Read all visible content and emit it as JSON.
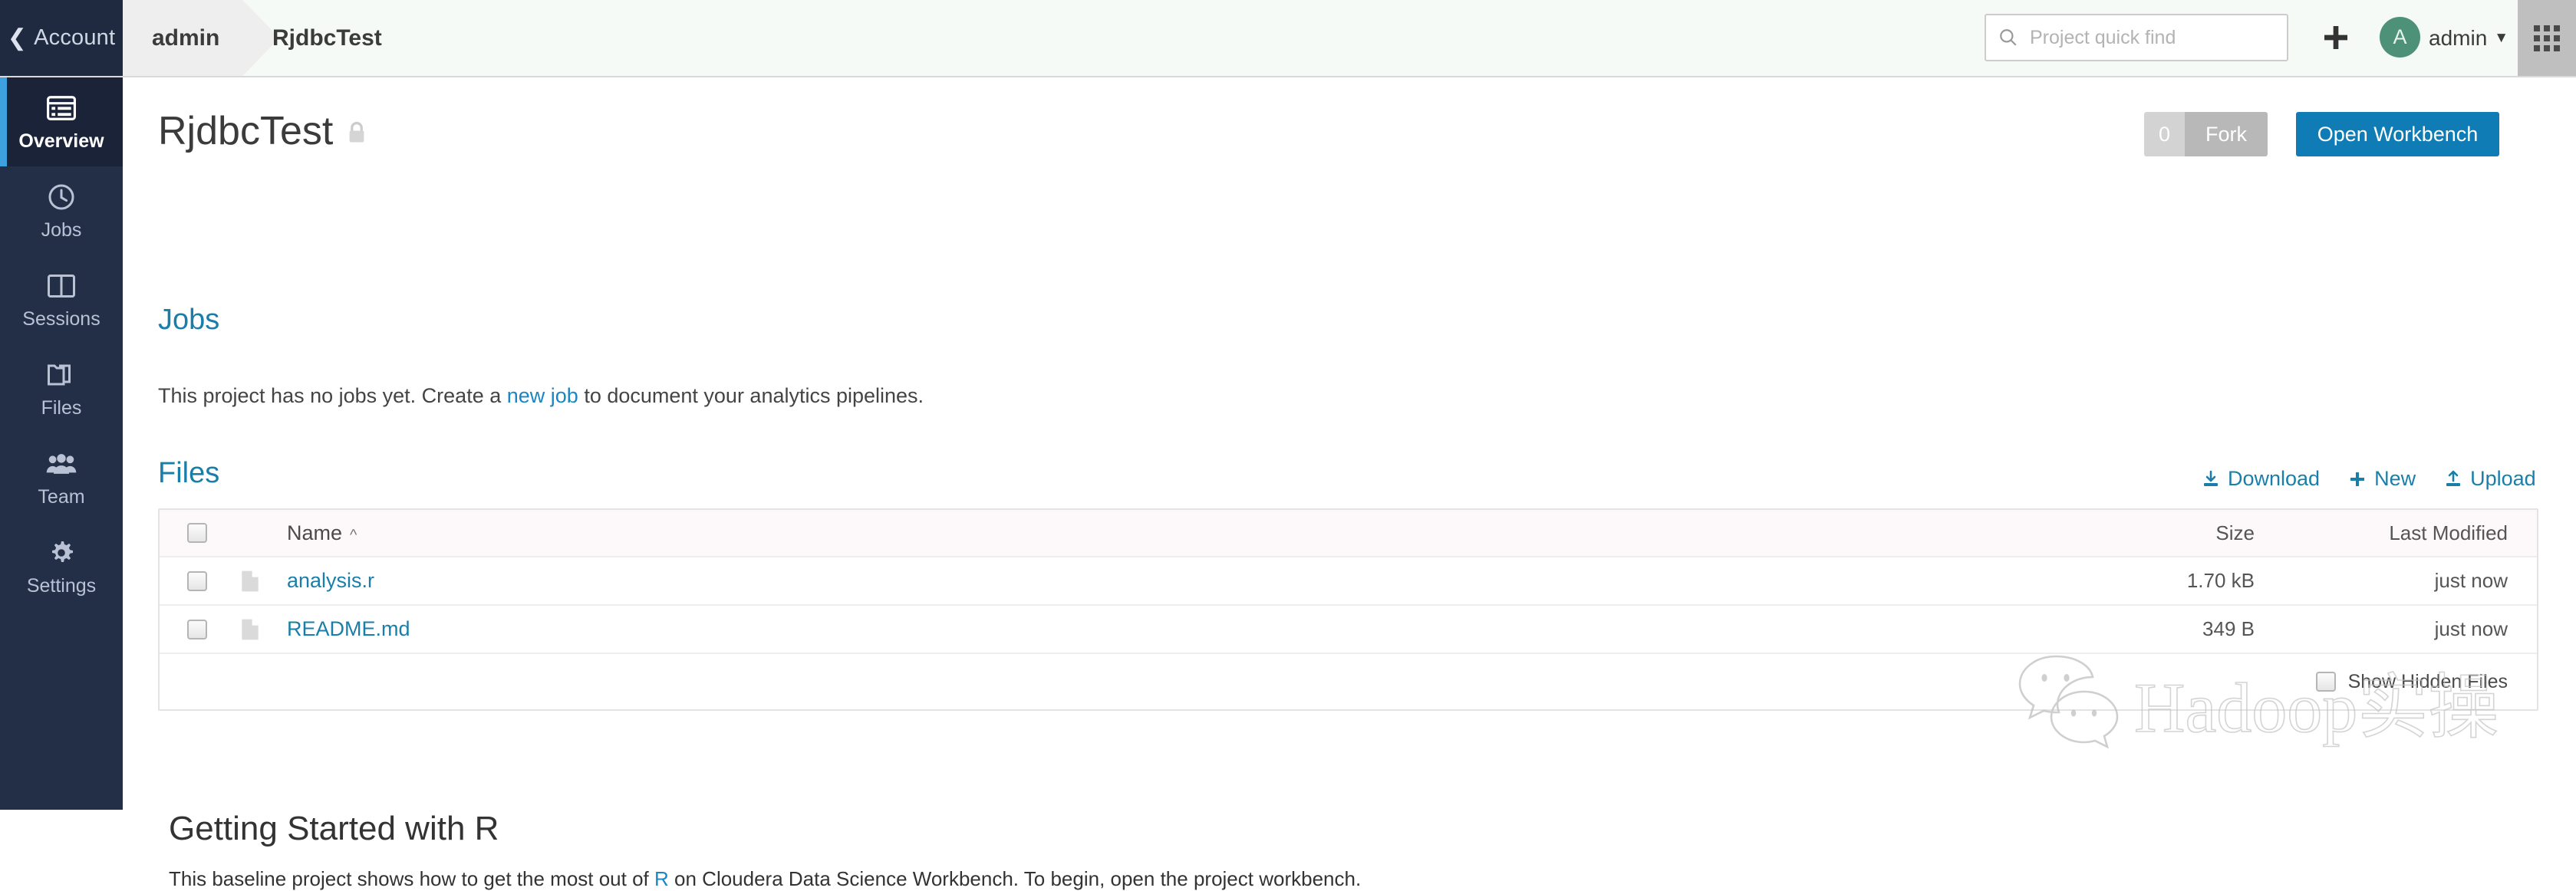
{
  "topbar": {
    "account_label": "Account",
    "back_chevron_icon": "chevron-left-icon",
    "breadcrumb": {
      "owner": "admin",
      "project": "RjdbcTest"
    },
    "search": {
      "placeholder": "Project quick find",
      "value": "",
      "icon": "search-icon"
    },
    "add_icon": "plus-icon",
    "avatar_initial": "A",
    "user_label": "admin",
    "user_caret_icon": "caret-down-icon",
    "app_grid_icon": "app-grid-icon"
  },
  "sidebar": {
    "items": [
      {
        "label": "Overview",
        "icon": "overview-icon",
        "active": true
      },
      {
        "label": "Jobs",
        "icon": "clock-icon",
        "active": false
      },
      {
        "label": "Sessions",
        "icon": "columns-icon",
        "active": false
      },
      {
        "label": "Files",
        "icon": "files-icon",
        "active": false
      },
      {
        "label": "Team",
        "icon": "team-icon",
        "active": false
      },
      {
        "label": "Settings",
        "icon": "gear-icon",
        "active": false
      }
    ]
  },
  "project": {
    "title": "RjdbcTest",
    "visibility_icon": "lock-icon",
    "fork": {
      "count": "0",
      "label": "Fork"
    },
    "open_workbench_label": "Open Workbench"
  },
  "jobs": {
    "heading": "Jobs",
    "empty_text_before": "This project has no jobs yet. Create a ",
    "empty_link": "new job",
    "empty_text_after": " to document your analytics pipelines."
  },
  "files": {
    "heading": "Files",
    "actions": [
      {
        "label": "Download",
        "icon": "download-icon"
      },
      {
        "label": "New",
        "icon": "plus-icon"
      },
      {
        "label": "Upload",
        "icon": "upload-icon"
      }
    ],
    "columns": {
      "name": "Name",
      "size": "Size",
      "modified": "Last Modified"
    },
    "sort": {
      "column": "Name",
      "direction": "asc",
      "icon": "caret-up-icon"
    },
    "rows": [
      {
        "name": "analysis.r",
        "size": "1.70 kB",
        "modified": "just now",
        "icon": "file-icon",
        "checked": false
      },
      {
        "name": "README.md",
        "size": "349 B",
        "modified": "just now",
        "icon": "file-icon",
        "checked": false
      }
    ],
    "show_hidden_label": "Show Hidden Files",
    "show_hidden_checked": false
  },
  "getting_started": {
    "heading": "Getting Started with R",
    "body_before": "This baseline project shows how to get the most out of ",
    "body_link": "R",
    "body_after": " on Cloudera Data Science Workbench. To begin, open the project workbench."
  },
  "watermark": {
    "text": "Hadoop实操",
    "icon": "wechat-icon"
  },
  "colors": {
    "sidebar_bg": "#232e47",
    "sidebar_active_bg": "#1b2338",
    "sidebar_accent": "#3da1e0",
    "primary_button": "#0f7cb5",
    "link": "#1a7fa8",
    "avatar_bg": "#4d9179"
  }
}
